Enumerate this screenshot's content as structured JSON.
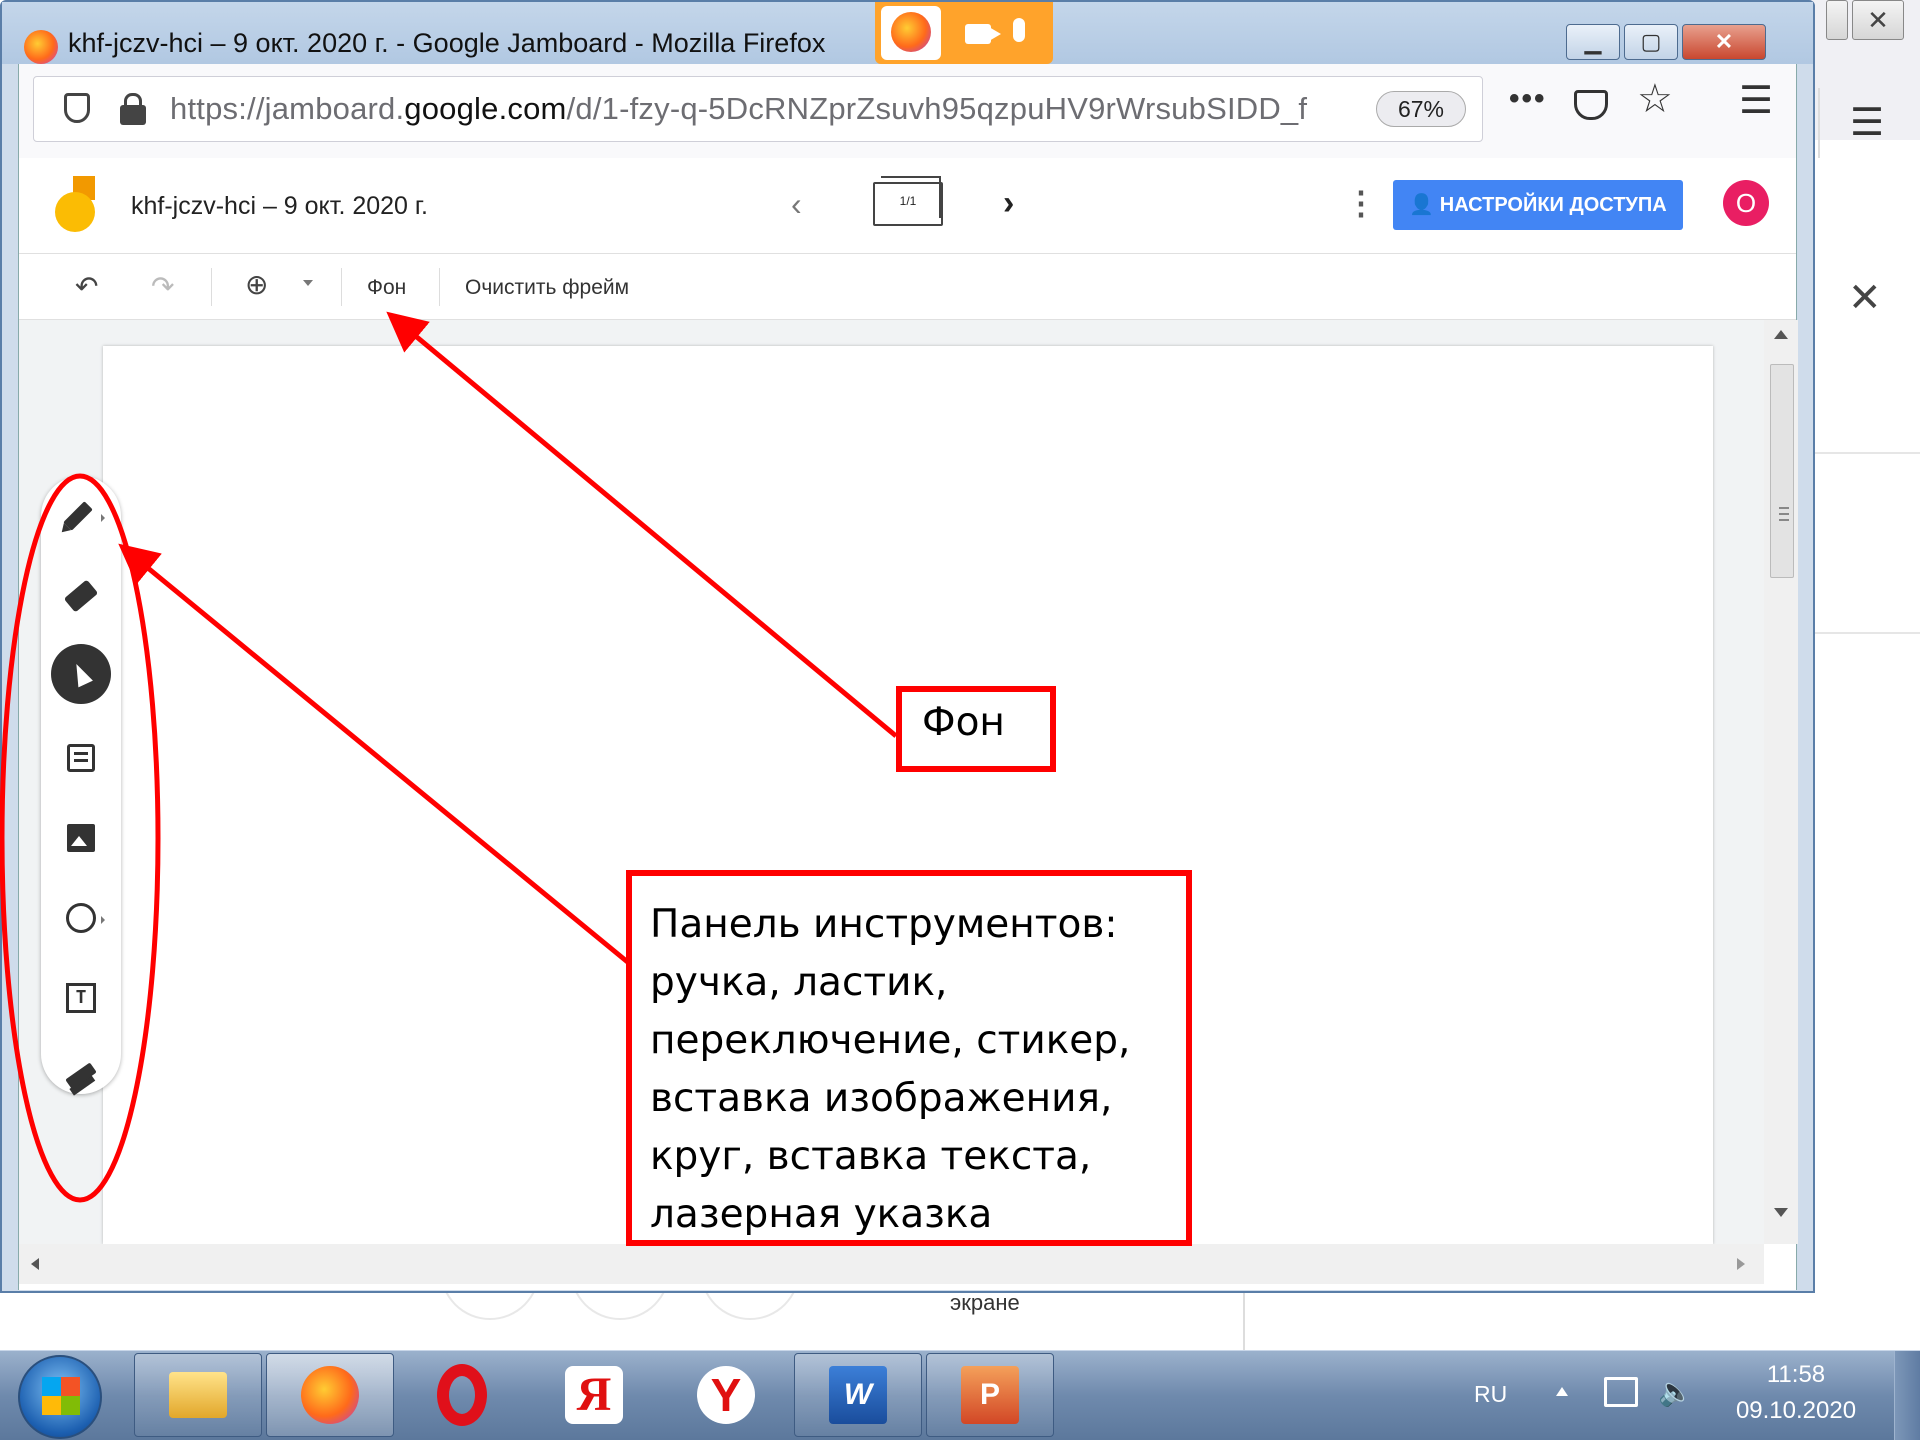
{
  "window": {
    "title": "khf-jczv-hci – 9 окт. 2020 г. - Google Jamboard - Mozilla Firefox",
    "url_prefix": "https://jamboard.",
    "url_domain": "google.com",
    "url_path": "/d/1-fzy-q-5DcRNZprZsuvh95qzpuHV9rWrsubSIDD_f",
    "zoom": "67%"
  },
  "app": {
    "doc_title": "khf-jczv-hci – 9 окт. 2020 г.",
    "frame_counter": "1/1",
    "share_label": "НАСТРОЙКИ ДОСТУПА",
    "avatar_letter": "О",
    "toolbar": {
      "background_label": "Фон",
      "clear_label": "Очистить фрейм"
    },
    "tools": [
      "pen",
      "eraser",
      "select",
      "sticky-note",
      "image",
      "circle",
      "text-box",
      "laser"
    ]
  },
  "background_window": {
    "caption": "экране"
  },
  "annotations": {
    "bg_callout": "Фон",
    "tools_callout": [
      "Панель  инструментов:",
      "ручка, ластик,",
      "переключение, стикер,",
      "вставка изображения,",
      "круг, вставка текста,",
      "лазерная указка"
    ],
    "highlight_color": "#ff0000"
  },
  "taskbar": {
    "apps": [
      "explorer",
      "firefox",
      "opera",
      "yandex-browser-ya",
      "yandex-browser",
      "word",
      "powerpoint"
    ],
    "language": "RU",
    "time": "11:58",
    "date": "09.10.2020"
  },
  "colors": {
    "share_button": "#4285f4",
    "avatar": "#e91e63",
    "jam_logo": "#fbbc04"
  }
}
